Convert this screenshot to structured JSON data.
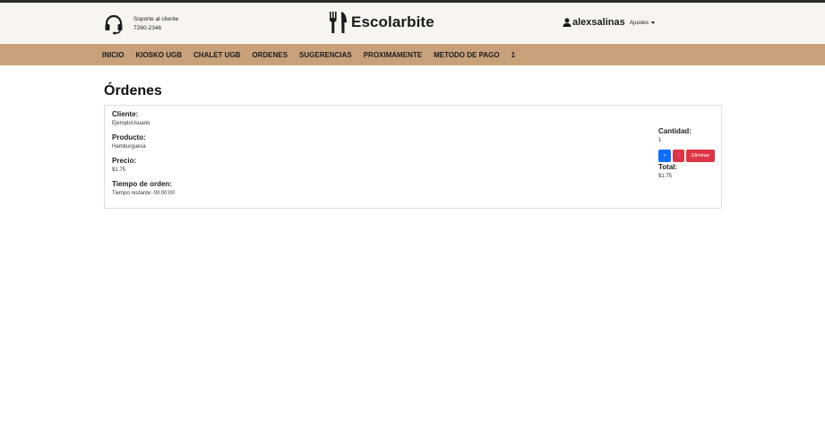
{
  "header": {
    "support_line1": "Soporte al cliente",
    "support_line2": "7260-2346",
    "brand": "Escolarbite",
    "username": "alexsalinas",
    "settings_label": "Ajustes"
  },
  "nav": {
    "items": [
      "INICIO",
      "KIOSKO UGB",
      "CHALET UGB",
      "ORDENES",
      "SUGERENCIAS",
      "PROXIMAMENTE",
      "METODO DE PAGO",
      "1"
    ]
  },
  "page": {
    "title": "Órdenes"
  },
  "order": {
    "client_label": "Cliente:",
    "client_value": "EjemploUsuario",
    "product_label": "Producto:",
    "product_value": "Hamburguesa",
    "price_label": "Precio:",
    "price_value": "$1.75",
    "time_label": "Tiempo de orden:",
    "time_value": "Tiempo restante: 00:00:00",
    "quantity_label": "Cantidad:",
    "quantity_value": "1",
    "plus_label": "+",
    "minus_label": "-",
    "delete_label": "Eliminar",
    "total_label": "Total:",
    "total_value": "$1.75"
  },
  "colors": {
    "topbar_bg": "#f8f5f0",
    "nav_bg": "#c8a07a",
    "primary": "#0d6efd",
    "danger": "#dc3545"
  },
  "icons": [
    "headset-icon",
    "fork-knife-icon",
    "user-icon",
    "caret-down-icon"
  ]
}
